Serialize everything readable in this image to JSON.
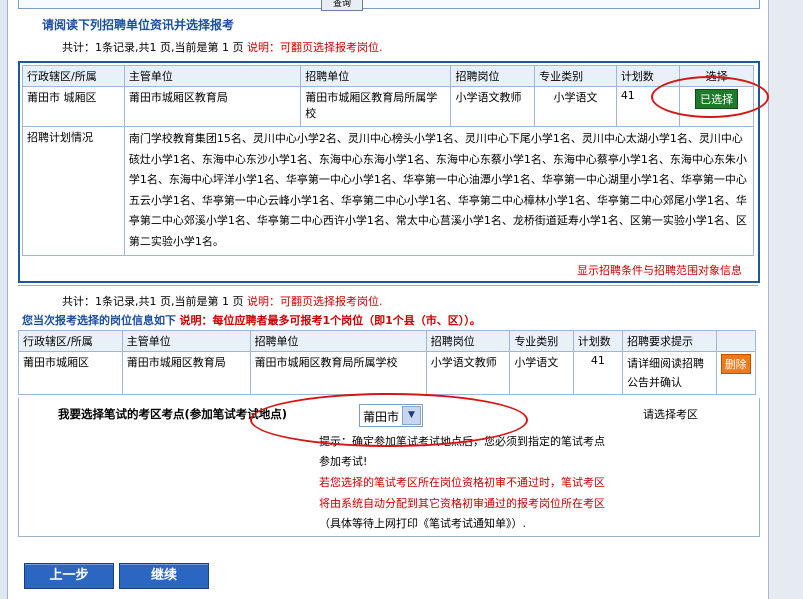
{
  "top": {
    "query_label": "查询"
  },
  "section1": {
    "title": "请阅读下列招聘单位资讯并选择报考",
    "summary_prefix": "共计：1条记录,共1 页,当前是第 1 页",
    "summary_note": "说明：可翻页选择报考岗位."
  },
  "table1": {
    "headers": [
      "行政辖区/所属",
      "主管单位",
      "招聘单位",
      "招聘岗位",
      "专业类别",
      "计划数",
      "选择"
    ],
    "row": {
      "region": "莆田市 城厢区",
      "authority": "莆田市城厢区教育局",
      "employer": "莆田市城厢区教育局所属学校",
      "position": "小学语文教师",
      "category": "小学语文",
      "count": "41",
      "select_label": "已选择"
    },
    "plan_label": "招聘计划情况",
    "plan_text": "南门学校教育集团15名、灵川中心小学2名、灵川中心榜头小学1名、灵川中心下尾小学1名、灵川中心太湖小学1名、灵川中心硋灶小学1名、东海中心东沙小学1名、东海中心东海小学1名、东海中心东蔡小学1名、东海中心蔡亭小学1名、东海中心东朱小学1名、东海中心坪洋小学1名、华亭第一中心小学1名、华亭第一中心油潭小学1名、华亭第一中心湖里小学1名、华亭第一中心五云小学1名、华亭第一中心云峰小学1名、华亭第二中心小学1名、华亭第二中心樟林小学1名、华亭第二中心郊尾小学1名、华亭第二中心郊溪小学1名、华亭第二中心西许小学1名、常太中心莒溪小学1名、龙桥街道延寿小学1名、区第一实验小学1名、区第二实验小学1名。",
    "show_link": "显示招聘条件与招聘范围对象信息"
  },
  "section2": {
    "summary_prefix": "共计：1条记录,共1 页,当前是第 1 页",
    "summary_note": "说明：可翻页选择报考岗位.",
    "title": "您当次报考选择的岗位信息如下",
    "title_note": "说明：每位应聘者最多可报考1个岗位（即1个县（市、区））。"
  },
  "table2": {
    "headers": [
      "行政辖区/所属",
      "主管单位",
      "招聘单位",
      "招聘岗位",
      "专业类别",
      "计划数",
      "招聘要求提示",
      ""
    ],
    "row": {
      "region": "莆田市城厢区",
      "authority": "莆田市城厢区教育局",
      "employer": "莆田市城厢区教育局所属学校",
      "position": "小学语文教师",
      "category": "小学语文",
      "count": "41",
      "hint": "请详细阅读招聘公告并确认",
      "delete_label": "删除"
    }
  },
  "exam": {
    "label": "我要选择笔试的考区考点(参加笔试考试地点)",
    "selected": "莆田市",
    "choose_hint": "请选择考区",
    "note1": "提示：确定参加笔试考试地点后，您必须到指定的笔试考点",
    "note2": "参加考试!",
    "note3": "若您选择的笔试考区所在岗位资格初审不通过时，笔试考区",
    "note4": "将由系统自动分配到其它资格初审通过的报考岗位所在考区",
    "note5": "（具体等待上网打印《笔试考试通知单》）."
  },
  "nav": {
    "prev_label": "上一步",
    "next_label": "继续"
  },
  "colors": {
    "accent": "#1c4fa0",
    "warn": "#cc0000",
    "select_green": "#1f7a2c",
    "delete_orange": "#f07a1a",
    "circle_red": "#d61616"
  }
}
